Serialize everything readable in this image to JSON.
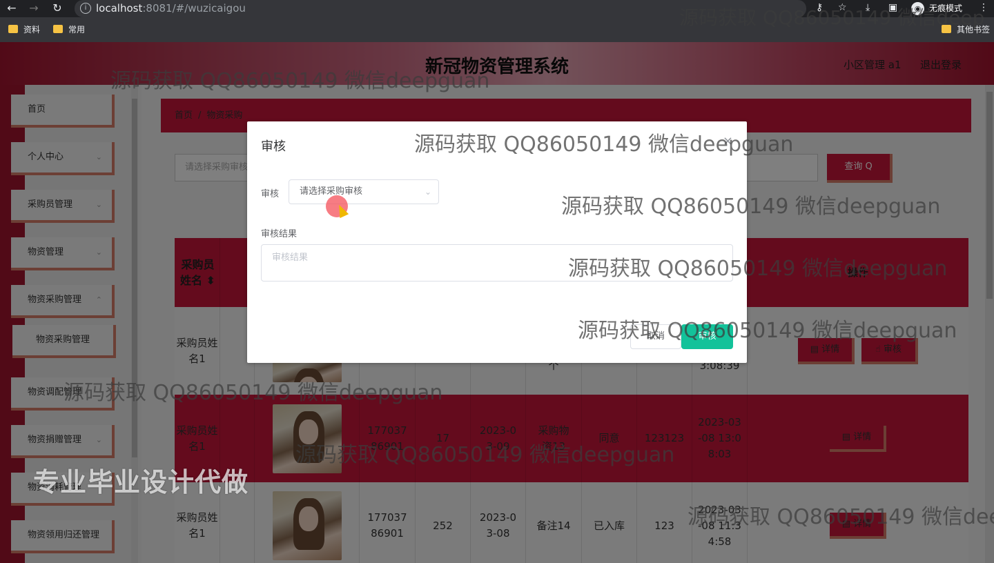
{
  "browser": {
    "url_host": "localhost",
    "url_path": ":8081/#/wuzicaigou",
    "incognito_label": "无痕模式",
    "bookmarks": [
      "资料",
      "常用",
      "其他书签"
    ]
  },
  "header": {
    "title": "新冠物资管理系统",
    "user": "小区管理 a1",
    "logout": "退出登录"
  },
  "sidebar": {
    "items": [
      {
        "label": "首页",
        "has_children": false
      },
      {
        "label": "个人中心",
        "has_children": true
      },
      {
        "label": "采购员管理",
        "has_children": true
      },
      {
        "label": "物资管理",
        "has_children": true
      },
      {
        "label": "物资采购管理",
        "has_children": true
      },
      {
        "label": "物资采购管理",
        "has_children": false,
        "sub": true
      },
      {
        "label": "物资调配管理",
        "has_children": false
      },
      {
        "label": "物资捐赠管理",
        "has_children": true
      },
      {
        "label": "物资消耗管理",
        "has_children": false
      },
      {
        "label": "物资领用归还管理",
        "has_children": false
      }
    ]
  },
  "breadcrumb": {
    "home": "首页",
    "separator": "/",
    "current": "物资采购"
  },
  "search": {
    "placeholder": "请选择采购审核",
    "query_label": "查询 Q"
  },
  "table": {
    "header_name": "采购员姓名 ⬍",
    "header_op": "操作",
    "rows": [
      {
        "name": "采购员姓名1",
        "phone": "",
        "qty": "",
        "date": "",
        "note": "个",
        "status": "",
        "code": "",
        "time": "3:08:39",
        "ops": [
          "详情",
          "审核"
        ]
      },
      {
        "name": "采购员姓名1",
        "phone": "17703786901",
        "qty": "17",
        "date": "2023-03-09",
        "note": "采购物资13",
        "status": "同意",
        "code": "123123",
        "time": "2023-03-08 13:08:03",
        "ops": [
          "详情"
        ]
      },
      {
        "name": "采购员姓名1",
        "phone": "17703786901",
        "qty": "252",
        "date": "2023-03-08",
        "note": "备注14",
        "status": "已入库",
        "code": "123",
        "time": "2023-03-08 11:34:58",
        "ops": [
          "详情"
        ]
      }
    ]
  },
  "dialog": {
    "title": "审核",
    "close": "×",
    "select_label": "审核",
    "select_placeholder": "请选择采购审核",
    "result_label": "审核结果",
    "result_placeholder": "审核结果",
    "cancel": "取消",
    "confirm": "审核"
  },
  "watermark": {
    "text": "源码获取 QQ86050149 微信deepguan",
    "text_cut": "源码获取 QQ86050149 微信deep",
    "overlay": "专业毕业设计代做"
  }
}
